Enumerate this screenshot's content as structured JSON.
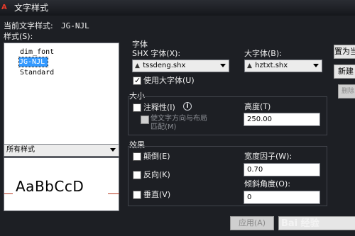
{
  "window": {
    "title": "文字样式",
    "app_logo": "A"
  },
  "current_style": {
    "label": "当前文字样式:",
    "value": "JG-NJL"
  },
  "styles": {
    "label": "样式(S):",
    "items": [
      "dim_font",
      "JG-NJL",
      "Standard"
    ],
    "selected": "JG-NJL"
  },
  "filter": {
    "value": "所有样式"
  },
  "preview": {
    "text": "AaBbCcD"
  },
  "font": {
    "group_label": "字体",
    "shx_label": "SHX 字体(X):",
    "shx_value": "tssdeng.shx",
    "big_label": "大字体(B):",
    "big_value": "hztxt.shx",
    "use_big_label": "使用大字体(U)",
    "use_big_checked": true
  },
  "size": {
    "group_label": "大小",
    "annotative_label": "注释性(I)",
    "info_glyph": "i",
    "match_label_line1": "使文字方向与布局",
    "match_label_line2": "匹配(M)",
    "height_label": "高度(T)",
    "height_value": "250.00"
  },
  "effects": {
    "group_label": "效果",
    "upside_label": "颠倒(E)",
    "backwards_label": "反向(K)",
    "vertical_label": "垂直(V)",
    "width_label": "宽度因子(W):",
    "width_value": "0.70",
    "oblique_label": "倾斜角度(O):",
    "oblique_value": "0"
  },
  "buttons": {
    "set_current": "置为当",
    "new": "新建",
    "delete": "删除",
    "apply": "应用(A)"
  },
  "watermark": {
    "text": "Bai 经验"
  },
  "colors": {
    "selection": "#3399ff",
    "background": "#1d1f24",
    "preview_baseline": "#b5371f"
  }
}
